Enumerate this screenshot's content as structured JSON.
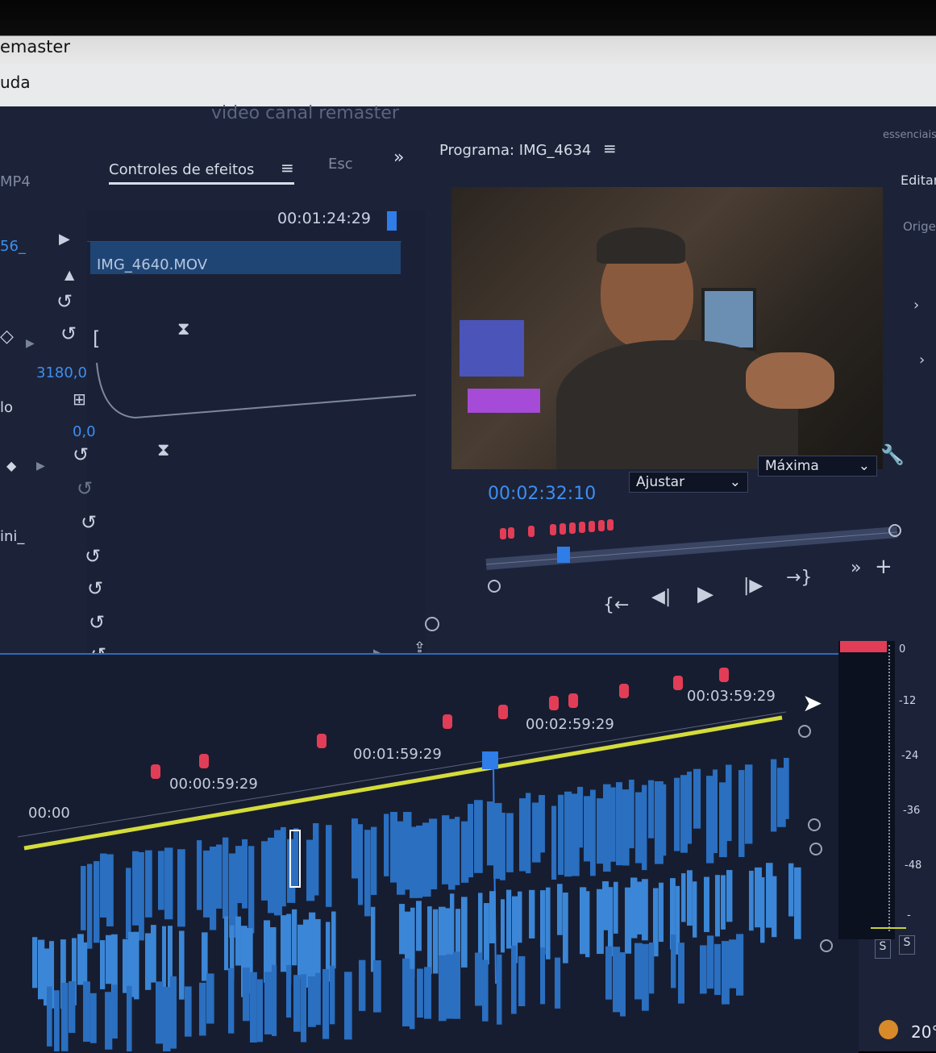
{
  "window": {
    "title": "emaster",
    "menu": "uda"
  },
  "project_title": "video canal remaster",
  "left_panel": {
    "tab_partial": "MP4",
    "tab_effects": "Controles de efeitos",
    "tab_menu_icon": "≡",
    "tab_next": "Esc",
    "overflow": "»",
    "clip_partial": "56_",
    "row_label_1": "lo",
    "row_label_2": "ini_",
    "value_high": "3180,0",
    "value_low": "0,0"
  },
  "effect_controls": {
    "timecode": "00:01:24:29",
    "clip_name": "IMG_4640.MOV"
  },
  "program_monitor": {
    "title": "Programa: IMG_4634",
    "menu_icon": "≡",
    "timecode": "00:02:32:10",
    "fit": "Ajustar",
    "quality": "Máxima"
  },
  "right_panel": {
    "tab_partial": "essenciais",
    "edit_label": "Editar",
    "origin_partial": "Orige"
  },
  "timeline": {
    "ticks": [
      "00:00",
      "00:00:59:29",
      "00:01:59:29",
      "00:02:59:29",
      "00:03:59:29"
    ]
  },
  "meter": {
    "labels": [
      "0",
      "-12",
      "-24",
      "-36",
      "-48",
      "-"
    ],
    "solo_left": "S",
    "solo_right": "S"
  },
  "taskbar": {
    "temp": "20°"
  },
  "colors": {
    "accent": "#3d8ef0",
    "marker": "#e23d57",
    "clip": "#2a6fc0",
    "yellow_line": "#d4dc3a"
  }
}
